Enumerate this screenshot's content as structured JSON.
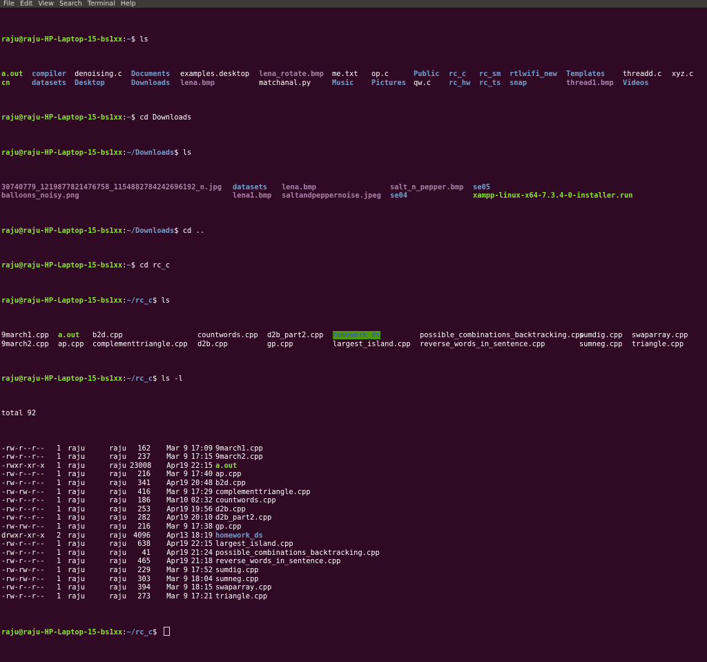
{
  "menu": [
    "File",
    "Edit",
    "View",
    "Search",
    "Terminal",
    "Help"
  ],
  "prompt": {
    "user": "raju@raju-HP-Laptop-15-bs1xx",
    "home": "~",
    "downloads": "~/Downloads",
    "rc_c": "~/rc_c",
    "suffix": "$ "
  },
  "cmd": {
    "ls": "ls",
    "cd_downloads": "cd Downloads",
    "cd_up": "cd ..",
    "cd_rc_c": "cd rc_c",
    "ls_l": "ls -l"
  },
  "home_ls": [
    [
      {
        "t": "a.out",
        "c": "exec"
      },
      {
        "t": "compiler",
        "c": "dir"
      },
      {
        "t": "denoising.c",
        "c": "file"
      },
      {
        "t": "Documents",
        "c": "dir"
      },
      {
        "t": "examples.desktop",
        "c": "file"
      },
      {
        "t": "lena_rotate.bmp",
        "c": "img"
      },
      {
        "t": "me.txt",
        "c": "file"
      },
      {
        "t": "op.c",
        "c": "file"
      },
      {
        "t": "Public",
        "c": "dir"
      },
      {
        "t": "rc_c",
        "c": "dir"
      },
      {
        "t": "rc_sm",
        "c": "dir"
      },
      {
        "t": "rtlwifi_new",
        "c": "dir"
      },
      {
        "t": "Templates",
        "c": "dir"
      },
      {
        "t": "threadd.c",
        "c": "file"
      },
      {
        "t": "xyz.c",
        "c": "file"
      }
    ],
    [
      {
        "t": "cn",
        "c": "exec"
      },
      {
        "t": "datasets",
        "c": "dir"
      },
      {
        "t": "Desktop",
        "c": "dir"
      },
      {
        "t": "Downloads",
        "c": "dir"
      },
      {
        "t": "lena.bmp",
        "c": "img"
      },
      {
        "t": "matchanal.py",
        "c": "file"
      },
      {
        "t": "Music",
        "c": "dir"
      },
      {
        "t": "Pictures",
        "c": "dir"
      },
      {
        "t": "qw.c",
        "c": "file"
      },
      {
        "t": "rc_hw",
        "c": "dir"
      },
      {
        "t": "rc_ts",
        "c": "dir"
      },
      {
        "t": "snap",
        "c": "dir"
      },
      {
        "t": "thread1.bmp",
        "c": "img"
      },
      {
        "t": "Videos",
        "c": "dir"
      }
    ]
  ],
  "downloads_ls": [
    [
      {
        "t": "30740779_1219877821476758_1154882784242696192_n.jpg",
        "c": "img"
      },
      {
        "t": "datasets",
        "c": "dir"
      },
      {
        "t": "lena.bmp",
        "c": "img"
      },
      {
        "t": "salt_n_pepper.bmp",
        "c": "img"
      },
      {
        "t": "se05",
        "c": "dir"
      }
    ],
    [
      {
        "t": "balloons_noisy.png",
        "c": "img"
      },
      {
        "t": "lena1.bmp",
        "c": "img"
      },
      {
        "t": "saltandpeppernoise.jpeg",
        "c": "img"
      },
      {
        "t": "se04",
        "c": "dir"
      },
      {
        "t": "xampp-linux-x64-7.3.4-0-installer.run",
        "c": "exec"
      }
    ]
  ],
  "rc_ls": [
    [
      {
        "t": "9march1.cpp",
        "c": "file"
      },
      {
        "t": "a.out",
        "c": "exec"
      },
      {
        "t": "b2d.cpp",
        "c": "file"
      },
      {
        "t": "countwords.cpp",
        "c": "file"
      },
      {
        "t": "d2b_part2.cpp",
        "c": "file"
      },
      {
        "t": "homework_ds",
        "c": "hl"
      },
      {
        "t": "possible_combinations_backtracking.cpp",
        "c": "file"
      },
      {
        "t": "sumdig.cpp",
        "c": "file"
      },
      {
        "t": "swaparray.cpp",
        "c": "file"
      }
    ],
    [
      {
        "t": "9march2.cpp",
        "c": "file"
      },
      {
        "t": "ap.cpp",
        "c": "file"
      },
      {
        "t": "complementtriangle.cpp",
        "c": "file"
      },
      {
        "t": "d2b.cpp",
        "c": "file"
      },
      {
        "t": "gp.cpp",
        "c": "file"
      },
      {
        "t": "largest_island.cpp",
        "c": "file"
      },
      {
        "t": "reverse_words_in_sentence.cpp",
        "c": "file"
      },
      {
        "t": "sumneg.cpp",
        "c": "file"
      },
      {
        "t": "triangle.cpp",
        "c": "file"
      }
    ]
  ],
  "total": "total 92",
  "lsl_rows": [
    {
      "perm": "-rw-r--r--",
      "links": "1",
      "owner": "raju",
      "group": "raju",
      "size": "162",
      "mon": "Mar",
      "day": "9",
      "time": "17:09",
      "name": "9march1.cpp",
      "c": "file"
    },
    {
      "perm": "-rw-r--r--",
      "links": "1",
      "owner": "raju",
      "group": "raju",
      "size": "237",
      "mon": "Mar",
      "day": "9",
      "time": "17:15",
      "name": "9march2.cpp",
      "c": "file"
    },
    {
      "perm": "-rwxr-xr-x",
      "links": "1",
      "owner": "raju",
      "group": "raju",
      "size": "23008",
      "mon": "Apr",
      "day": "19",
      "time": "22:15",
      "name": "a.out",
      "c": "exec"
    },
    {
      "perm": "-rw-r--r--",
      "links": "1",
      "owner": "raju",
      "group": "raju",
      "size": "216",
      "mon": "Mar",
      "day": "9",
      "time": "17:40",
      "name": "ap.cpp",
      "c": "file"
    },
    {
      "perm": "-rw-r--r--",
      "links": "1",
      "owner": "raju",
      "group": "raju",
      "size": "341",
      "mon": "Apr",
      "day": "19",
      "time": "20:48",
      "name": "b2d.cpp",
      "c": "file"
    },
    {
      "perm": "-rw-rw-r--",
      "links": "1",
      "owner": "raju",
      "group": "raju",
      "size": "416",
      "mon": "Mar",
      "day": "9",
      "time": "17:29",
      "name": "complementtriangle.cpp",
      "c": "file"
    },
    {
      "perm": "-rw-r--r--",
      "links": "1",
      "owner": "raju",
      "group": "raju",
      "size": "186",
      "mon": "Mar",
      "day": "10",
      "time": "02:32",
      "name": "countwords.cpp",
      "c": "file"
    },
    {
      "perm": "-rw-r--r--",
      "links": "1",
      "owner": "raju",
      "group": "raju",
      "size": "253",
      "mon": "Apr",
      "day": "19",
      "time": "19:56",
      "name": "d2b.cpp",
      "c": "file"
    },
    {
      "perm": "-rw-r--r--",
      "links": "1",
      "owner": "raju",
      "group": "raju",
      "size": "282",
      "mon": "Apr",
      "day": "19",
      "time": "20:10",
      "name": "d2b_part2.cpp",
      "c": "file"
    },
    {
      "perm": "-rw-rw-r--",
      "links": "1",
      "owner": "raju",
      "group": "raju",
      "size": "216",
      "mon": "Mar",
      "day": "9",
      "time": "17:38",
      "name": "gp.cpp",
      "c": "file"
    },
    {
      "perm": "drwxr-xr-x",
      "links": "2",
      "owner": "raju",
      "group": "raju",
      "size": "4096",
      "mon": "Apr",
      "day": "13",
      "time": "18:19",
      "name": "homework_ds",
      "c": "dir"
    },
    {
      "perm": "-rw-r--r--",
      "links": "1",
      "owner": "raju",
      "group": "raju",
      "size": "638",
      "mon": "Apr",
      "day": "19",
      "time": "22:15",
      "name": "largest_island.cpp",
      "c": "file"
    },
    {
      "perm": "-rw-r--r--",
      "links": "1",
      "owner": "raju",
      "group": "raju",
      "size": "41",
      "mon": "Apr",
      "day": "19",
      "time": "21:24",
      "name": "possible_combinations_backtracking.cpp",
      "c": "file"
    },
    {
      "perm": "-rw-r--r--",
      "links": "1",
      "owner": "raju",
      "group": "raju",
      "size": "465",
      "mon": "Apr",
      "day": "19",
      "time": "21:18",
      "name": "reverse_words_in_sentence.cpp",
      "c": "file"
    },
    {
      "perm": "-rw-rw-r--",
      "links": "1",
      "owner": "raju",
      "group": "raju",
      "size": "229",
      "mon": "Mar",
      "day": "9",
      "time": "17:52",
      "name": "sumdig.cpp",
      "c": "file"
    },
    {
      "perm": "-rw-rw-r--",
      "links": "1",
      "owner": "raju",
      "group": "raju",
      "size": "303",
      "mon": "Mar",
      "day": "9",
      "time": "18:04",
      "name": "sumneg.cpp",
      "c": "file"
    },
    {
      "perm": "-rw-r--r--",
      "links": "1",
      "owner": "raju",
      "group": "raju",
      "size": "394",
      "mon": "Mar",
      "day": "9",
      "time": "18:15",
      "name": "swaparray.cpp",
      "c": "file"
    },
    {
      "perm": "-rw-r--r--",
      "links": "1",
      "owner": "raju",
      "group": "raju",
      "size": "273",
      "mon": "Mar",
      "day": "9",
      "time": "17:21",
      "name": "triangle.cpp",
      "c": "file"
    }
  ]
}
